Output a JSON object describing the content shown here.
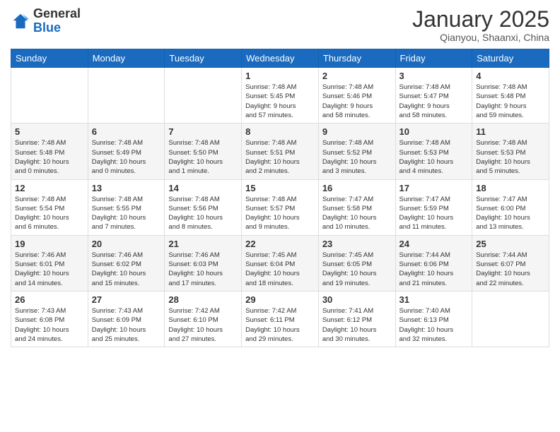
{
  "logo": {
    "text_general": "General",
    "text_blue": "Blue"
  },
  "header": {
    "month_title": "January 2025",
    "location": "Qianyou, Shaanxi, China"
  },
  "weekdays": [
    "Sunday",
    "Monday",
    "Tuesday",
    "Wednesday",
    "Thursday",
    "Friday",
    "Saturday"
  ],
  "weeks": [
    [
      {
        "day": "",
        "info": ""
      },
      {
        "day": "",
        "info": ""
      },
      {
        "day": "",
        "info": ""
      },
      {
        "day": "1",
        "info": "Sunrise: 7:48 AM\nSunset: 5:45 PM\nDaylight: 9 hours\nand 57 minutes."
      },
      {
        "day": "2",
        "info": "Sunrise: 7:48 AM\nSunset: 5:46 PM\nDaylight: 9 hours\nand 58 minutes."
      },
      {
        "day": "3",
        "info": "Sunrise: 7:48 AM\nSunset: 5:47 PM\nDaylight: 9 hours\nand 58 minutes."
      },
      {
        "day": "4",
        "info": "Sunrise: 7:48 AM\nSunset: 5:48 PM\nDaylight: 9 hours\nand 59 minutes."
      }
    ],
    [
      {
        "day": "5",
        "info": "Sunrise: 7:48 AM\nSunset: 5:48 PM\nDaylight: 10 hours\nand 0 minutes."
      },
      {
        "day": "6",
        "info": "Sunrise: 7:48 AM\nSunset: 5:49 PM\nDaylight: 10 hours\nand 0 minutes."
      },
      {
        "day": "7",
        "info": "Sunrise: 7:48 AM\nSunset: 5:50 PM\nDaylight: 10 hours\nand 1 minute."
      },
      {
        "day": "8",
        "info": "Sunrise: 7:48 AM\nSunset: 5:51 PM\nDaylight: 10 hours\nand 2 minutes."
      },
      {
        "day": "9",
        "info": "Sunrise: 7:48 AM\nSunset: 5:52 PM\nDaylight: 10 hours\nand 3 minutes."
      },
      {
        "day": "10",
        "info": "Sunrise: 7:48 AM\nSunset: 5:53 PM\nDaylight: 10 hours\nand 4 minutes."
      },
      {
        "day": "11",
        "info": "Sunrise: 7:48 AM\nSunset: 5:53 PM\nDaylight: 10 hours\nand 5 minutes."
      }
    ],
    [
      {
        "day": "12",
        "info": "Sunrise: 7:48 AM\nSunset: 5:54 PM\nDaylight: 10 hours\nand 6 minutes."
      },
      {
        "day": "13",
        "info": "Sunrise: 7:48 AM\nSunset: 5:55 PM\nDaylight: 10 hours\nand 7 minutes."
      },
      {
        "day": "14",
        "info": "Sunrise: 7:48 AM\nSunset: 5:56 PM\nDaylight: 10 hours\nand 8 minutes."
      },
      {
        "day": "15",
        "info": "Sunrise: 7:48 AM\nSunset: 5:57 PM\nDaylight: 10 hours\nand 9 minutes."
      },
      {
        "day": "16",
        "info": "Sunrise: 7:47 AM\nSunset: 5:58 PM\nDaylight: 10 hours\nand 10 minutes."
      },
      {
        "day": "17",
        "info": "Sunrise: 7:47 AM\nSunset: 5:59 PM\nDaylight: 10 hours\nand 11 minutes."
      },
      {
        "day": "18",
        "info": "Sunrise: 7:47 AM\nSunset: 6:00 PM\nDaylight: 10 hours\nand 13 minutes."
      }
    ],
    [
      {
        "day": "19",
        "info": "Sunrise: 7:46 AM\nSunset: 6:01 PM\nDaylight: 10 hours\nand 14 minutes."
      },
      {
        "day": "20",
        "info": "Sunrise: 7:46 AM\nSunset: 6:02 PM\nDaylight: 10 hours\nand 15 minutes."
      },
      {
        "day": "21",
        "info": "Sunrise: 7:46 AM\nSunset: 6:03 PM\nDaylight: 10 hours\nand 17 minutes."
      },
      {
        "day": "22",
        "info": "Sunrise: 7:45 AM\nSunset: 6:04 PM\nDaylight: 10 hours\nand 18 minutes."
      },
      {
        "day": "23",
        "info": "Sunrise: 7:45 AM\nSunset: 6:05 PM\nDaylight: 10 hours\nand 19 minutes."
      },
      {
        "day": "24",
        "info": "Sunrise: 7:44 AM\nSunset: 6:06 PM\nDaylight: 10 hours\nand 21 minutes."
      },
      {
        "day": "25",
        "info": "Sunrise: 7:44 AM\nSunset: 6:07 PM\nDaylight: 10 hours\nand 22 minutes."
      }
    ],
    [
      {
        "day": "26",
        "info": "Sunrise: 7:43 AM\nSunset: 6:08 PM\nDaylight: 10 hours\nand 24 minutes."
      },
      {
        "day": "27",
        "info": "Sunrise: 7:43 AM\nSunset: 6:09 PM\nDaylight: 10 hours\nand 25 minutes."
      },
      {
        "day": "28",
        "info": "Sunrise: 7:42 AM\nSunset: 6:10 PM\nDaylight: 10 hours\nand 27 minutes."
      },
      {
        "day": "29",
        "info": "Sunrise: 7:42 AM\nSunset: 6:11 PM\nDaylight: 10 hours\nand 29 minutes."
      },
      {
        "day": "30",
        "info": "Sunrise: 7:41 AM\nSunset: 6:12 PM\nDaylight: 10 hours\nand 30 minutes."
      },
      {
        "day": "31",
        "info": "Sunrise: 7:40 AM\nSunset: 6:13 PM\nDaylight: 10 hours\nand 32 minutes."
      },
      {
        "day": "",
        "info": ""
      }
    ]
  ]
}
